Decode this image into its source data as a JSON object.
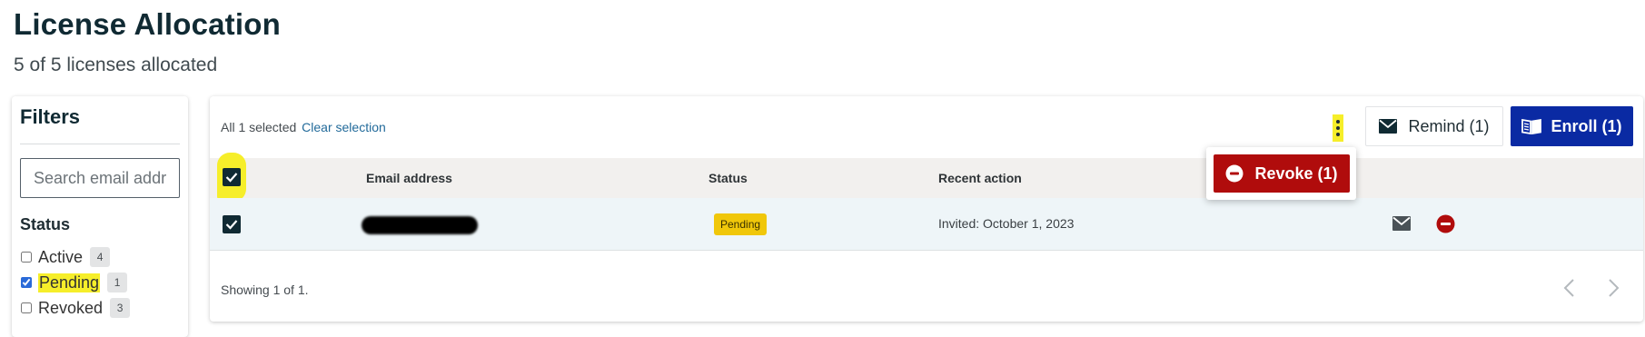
{
  "page": {
    "title": "License Allocation",
    "subtitle": "5 of 5 licenses allocated"
  },
  "filters": {
    "title": "Filters",
    "search_placeholder": "Search email address",
    "search_value": "",
    "status_heading": "Status",
    "options": [
      {
        "label": "Active",
        "count": "4",
        "checked": false
      },
      {
        "label": "Pending",
        "count": "1",
        "checked": true
      },
      {
        "label": "Revoked",
        "count": "3",
        "checked": false
      }
    ]
  },
  "toolbar": {
    "selection_text": "All 1 selected",
    "clear_selection": "Clear selection",
    "remind_label": "Remind (1)",
    "enroll_label": "Enroll (1)",
    "revoke_label": "Revoke (1)"
  },
  "table": {
    "columns": [
      "Email address",
      "Status",
      "Recent action"
    ],
    "rows": [
      {
        "email": "",
        "status": "Pending",
        "recent_action": "Invited: October 1, 2023",
        "selected": true
      }
    ],
    "footer": "Showing 1 of 1."
  },
  "colors": {
    "primary": "#0a2aa3",
    "danger": "#b00c0c",
    "highlight": "#f6ee2a",
    "pending": "#f0c70a",
    "header_bg": "#f2f0ee"
  },
  "icons": {
    "kebab": "more-vertical-icon",
    "remind": "envelope-icon",
    "enroll": "book-open-icon",
    "revoke": "minus-circle-icon",
    "prev": "chevron-left-icon",
    "next": "chevron-right-icon"
  }
}
